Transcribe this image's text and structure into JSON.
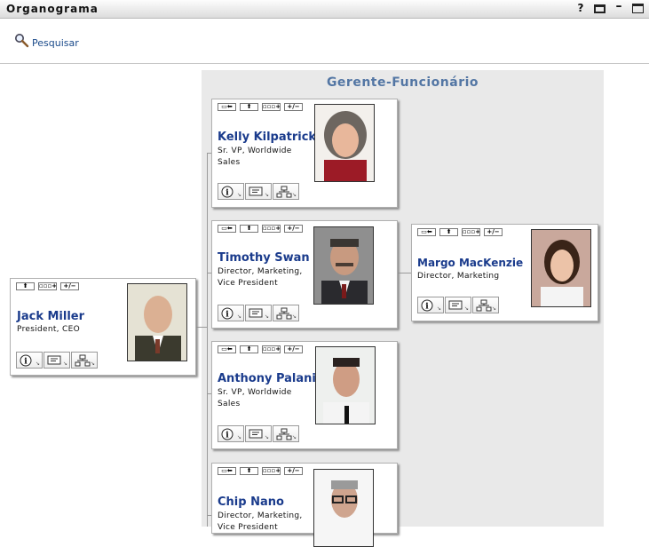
{
  "window": {
    "title": "Organograma",
    "help_icon": "?"
  },
  "toolbar": {
    "search_label": "Pesquisar"
  },
  "chart": {
    "heading": "Gerente-Funcionário"
  },
  "buttons": {
    "expand_children": "+/−"
  },
  "people": {
    "jack": {
      "name": "Jack Miller",
      "title": "President, CEO"
    },
    "kelly": {
      "name": "Kelly Kilpatrick",
      "title": "Sr. VP, Worldwide Sales"
    },
    "timothy": {
      "name": "Timothy Swan",
      "title": "Director, Marketing, Vice President"
    },
    "anthony": {
      "name": "Anthony Palani",
      "title": "Sr. VP, Worldwide Sales"
    },
    "chip": {
      "name": "Chip Nano",
      "title": "Director, Marketing, Vice President"
    },
    "margo": {
      "name": "Margo MacKenzie",
      "title": "Director, Marketing"
    }
  }
}
